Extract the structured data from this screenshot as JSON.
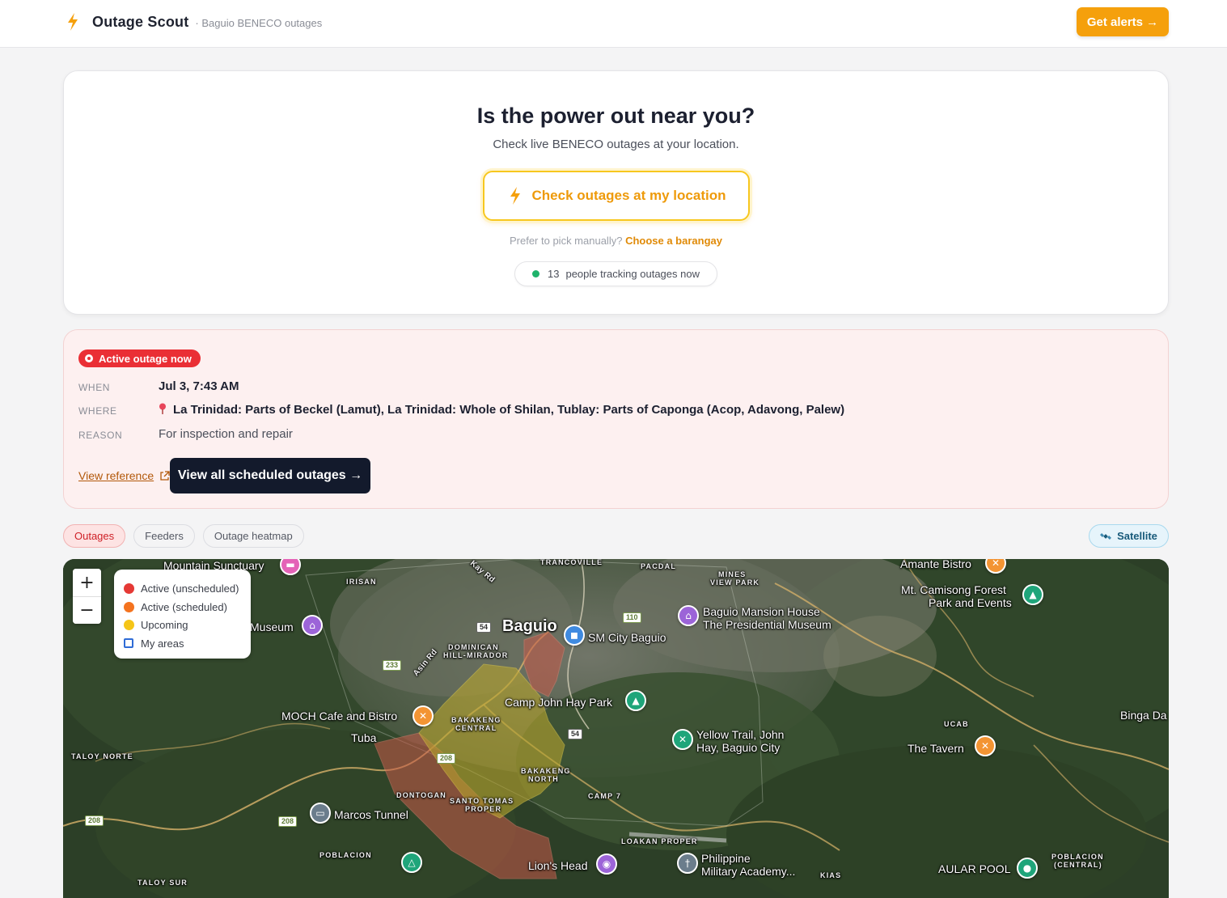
{
  "header": {
    "brand_name": "Outage Scout",
    "brand_sub": "· Baguio BENECO outages",
    "alerts_button": "Get alerts →"
  },
  "hero": {
    "title": "Is the power out near you?",
    "subtitle": "Check live BENECO outages at your location.",
    "check_button": "Check outages at my location",
    "manual_prefix": "Prefer to pick manually?",
    "manual_link": "Choose a barangay",
    "tracking_count": "13",
    "tracking_text": "people tracking outages now"
  },
  "outage": {
    "badge": "Active outage now",
    "when_label": "WHEN",
    "when_value": "Jul 3, 7:43 AM",
    "where_label": "WHERE",
    "where_value": "La Trinidad: Parts of Beckel (Lamut), La Trinidad: Whole of Shilan, Tublay: Parts of Caponga (Acop, Adavong, Palew)",
    "reason_label": "REASON",
    "reason_value": "For inspection and repair",
    "view_reference": "View reference",
    "all_button": "View all scheduled outages →"
  },
  "tabs": [
    {
      "label": "Outages",
      "active": true
    },
    {
      "label": "Feeders",
      "active": false
    },
    {
      "label": "Outage heatmap",
      "active": false
    }
  ],
  "satellite_label": "Satellite",
  "map": {
    "zoom_in": "+",
    "zoom_out": "−",
    "legend": [
      {
        "label": "Active (unscheduled)",
        "color": "#e53935"
      },
      {
        "label": "Active (scheduled)",
        "color": "#f4731f"
      },
      {
        "label": "Upcoming",
        "color": "#f5c518"
      },
      {
        "label": "My areas",
        "color": "#2f6cd6"
      }
    ],
    "places": {
      "mountain_sanctuary": "Mountain Sunctuary",
      "museum": "Museum",
      "baguio": "Baguio",
      "sm_city": "SM City Baguio",
      "mansion": "Baguio Mansion House",
      "presidential": "The Presidential Museum",
      "amante": "Amante Bistro",
      "mt_camisong_1": "Mt. Camisong Forest",
      "mt_camisong_2": "Park and Events",
      "camp_john_hay": "Camp John Hay Park",
      "moch": "MOCH Cafe and Bistro",
      "tuba": "Tuba",
      "yellow_trail_1": "Yellow Trail, John",
      "yellow_trail_2": "Hay, Baguio City",
      "binga": "Binga Da",
      "tavern": "The Tavern",
      "marcos_tunnel": "Marcos Tunnel",
      "lions_head": "Lion's Head",
      "pma_1": "Philippine",
      "pma_2": "Military Academy...",
      "aular_pool": "AULAR POOL"
    },
    "areas": {
      "irisan": "IRISAN",
      "trancoville": "TRANCOVILLE",
      "pacdal": "PACDAL",
      "mines_view_1": "MINES",
      "mines_view_2": "VIEW PARK",
      "dominican_1": "DOMINICAN",
      "dominican_2": "HILL-MIRADOR",
      "bakakeng_c1": "BAKAKENG",
      "bakakeng_c2": "CENTRAL",
      "bakakeng_n1": "BAKAKENG",
      "bakakeng_n2": "NORTH",
      "taloy_norte": "TALOY NORTE",
      "dontogan": "DONTOGAN",
      "santo_tomas_1": "SANTO TOMAS",
      "santo_tomas_2": "PROPER",
      "camp7": "CAMP 7",
      "ucab": "UCAB",
      "loakan": "LOAKAN PROPER",
      "poblacion": "POBLACION",
      "taloy_sur": "TALOY SUR",
      "poblacion_c1": "POBLACION",
      "poblacion_c2": "(CENTRAL)",
      "kias": "KIAS",
      "asin_rd": "Asin Rd",
      "kay_rd": "Kay Rd"
    },
    "road_shields": {
      "r54a": "54",
      "r110": "110",
      "r233": "233",
      "r54b": "54",
      "r208a": "208",
      "r208b": "208",
      "r208c": "208"
    }
  }
}
